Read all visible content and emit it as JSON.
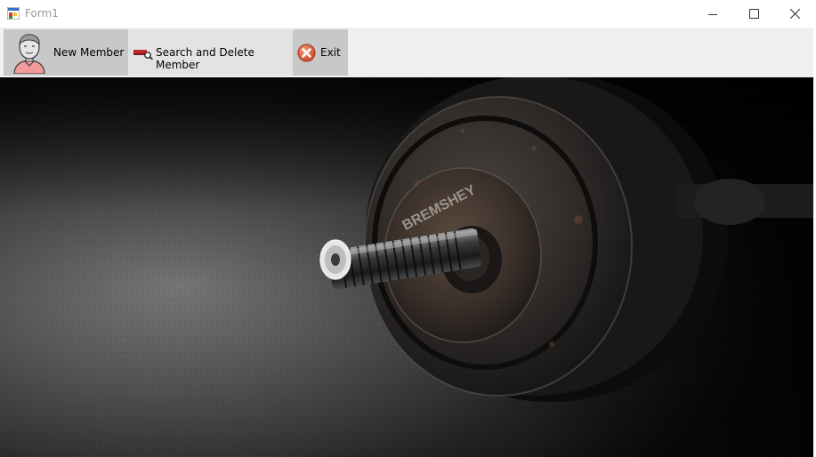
{
  "window": {
    "title": "Form1",
    "icon": "winforms-app-icon",
    "controls": {
      "minimize_icon": "minimize-icon",
      "maximize_icon": "maximize-icon",
      "close_icon": "close-icon"
    }
  },
  "toolbar": {
    "items": [
      {
        "label": "New Member",
        "icon": "member-avatar-icon"
      },
      {
        "label": "Search and Delete Member",
        "icon": "search-delete-icon"
      },
      {
        "label": "Exit",
        "icon": "exit-icon"
      }
    ]
  },
  "background": {
    "subject": "dumbbell-photo",
    "plate_text": "BREMSHEY",
    "colors": {
      "floor_light": "#8c8c8c",
      "floor_dark": "#0c0c0c",
      "plate": "#2d2a28",
      "rust": "#6b4632"
    }
  }
}
